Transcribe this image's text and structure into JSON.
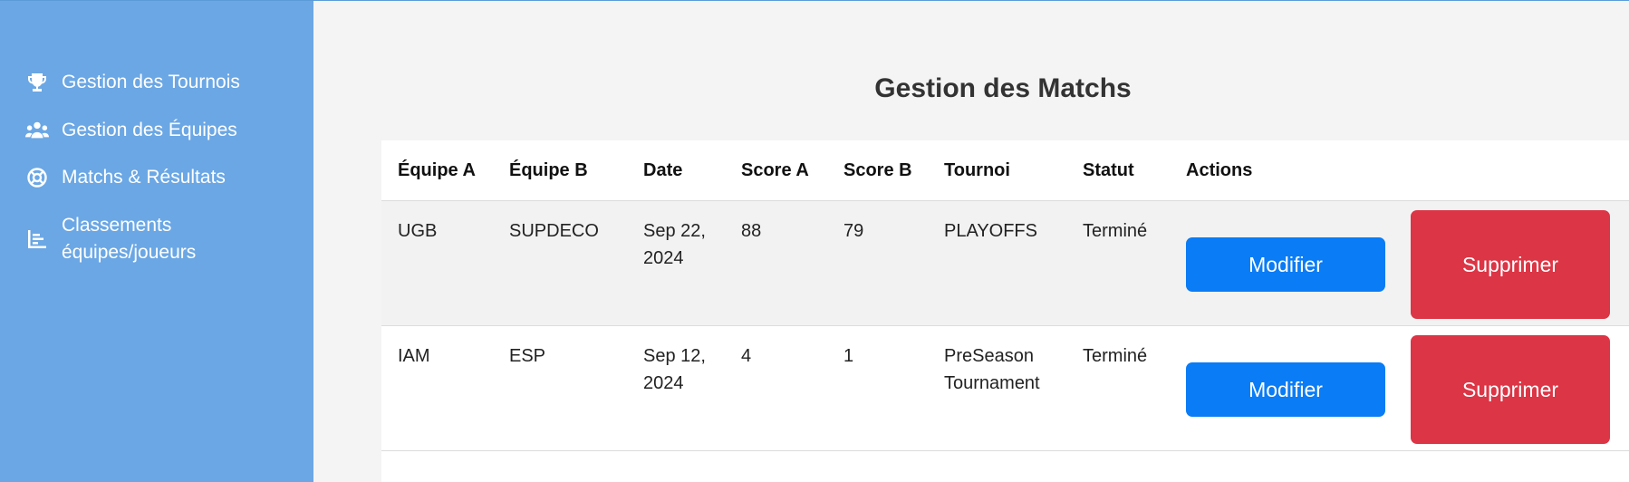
{
  "sidebar": {
    "items": [
      {
        "label": "Gestion des Tournois",
        "icon": "trophy-icon"
      },
      {
        "label": "Gestion des Équipes",
        "icon": "users-icon"
      },
      {
        "label": "Matchs & Résultats",
        "icon": "basketball-icon"
      },
      {
        "label": "Classements équipes/joueurs",
        "icon": "chart-bar-icon"
      }
    ],
    "color": "#6ba7e4"
  },
  "main": {
    "title": "Gestion des Matchs",
    "table": {
      "headers": [
        "Équipe A",
        "Équipe B",
        "Date",
        "Score A",
        "Score B",
        "Tournoi",
        "Statut",
        "Actions"
      ],
      "rows": [
        {
          "team_a": "UGB",
          "team_b": "SUPDECO",
          "date": "Sep 22, 2024",
          "score_a": "88",
          "score_b": "79",
          "tournament": "PLAYOFFS",
          "status": "Terminé"
        },
        {
          "team_a": "IAM",
          "team_b": "ESP",
          "date": "Sep 12, 2024",
          "score_a": "4",
          "score_b": "1",
          "tournament": "PreSeason Tournament",
          "status": "Terminé"
        }
      ]
    },
    "buttons": {
      "edit_label": "Modifier",
      "delete_label": "Supprimer"
    },
    "colors": {
      "edit": "#0a7cf5",
      "delete": "#dc3545"
    }
  }
}
